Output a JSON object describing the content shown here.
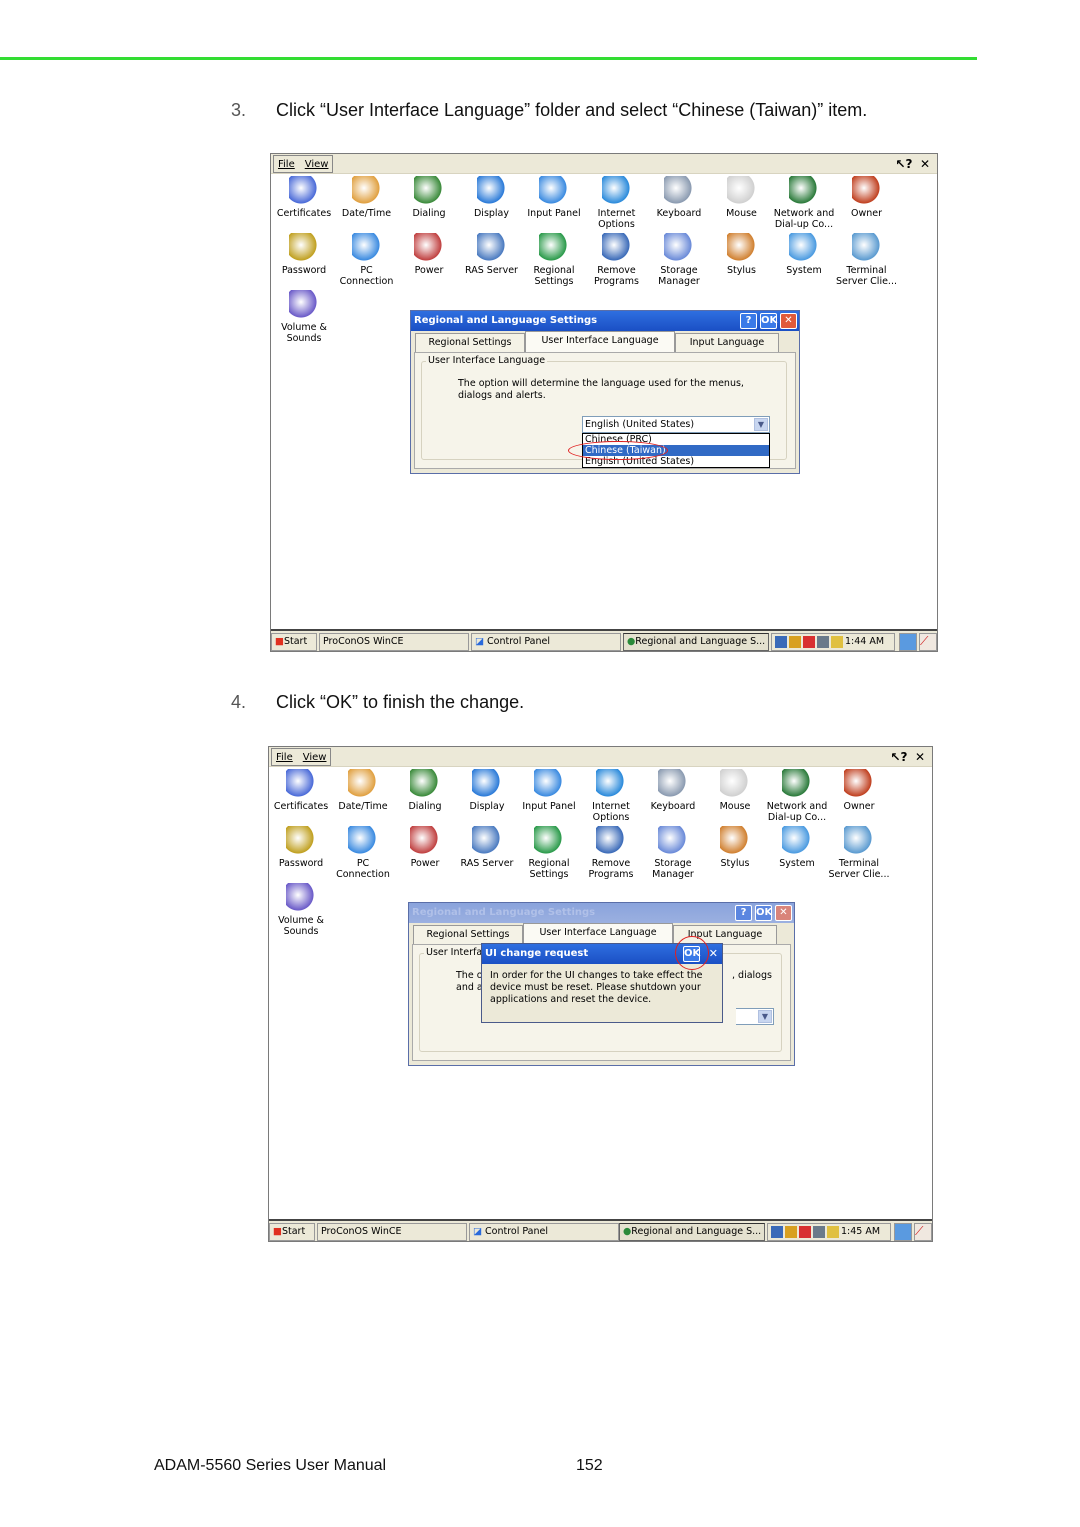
{
  "steps": [
    {
      "number": "3.",
      "text": "Click “User Interface Language” folder and select “Chinese (Taiwan)” item."
    },
    {
      "number": "4.",
      "text": "Click “OK” to finish the change."
    }
  ],
  "footer": {
    "manual": "ADAM-5560 Series User Manual",
    "page": "152"
  },
  "colors": {
    "rule": "#33dd33",
    "title_bar": "#1a4fc4",
    "selection": "#316ac5",
    "highlight_circle": "#e02020"
  },
  "screens": [
    {
      "menu": {
        "file": "File",
        "view": "View",
        "help_icon": "help-question-icon",
        "close_icon": "close-icon"
      },
      "control_panel_items": [
        {
          "label": "Certificates",
          "icon": "certificates-gear-icon"
        },
        {
          "label": "Date/Time",
          "icon": "date-time-clock-icon"
        },
        {
          "label": "Dialing",
          "icon": "dialing-phone-icon"
        },
        {
          "label": "Display",
          "icon": "display-monitor-icon"
        },
        {
          "label": "Input Panel",
          "icon": "input-panel-icon"
        },
        {
          "label": "Internet\nOptions",
          "icon": "internet-options-globe-icon"
        },
        {
          "label": "Keyboard",
          "icon": "keyboard-icon"
        },
        {
          "label": "Mouse",
          "icon": "mouse-icon"
        },
        {
          "label": "Network and\nDial-up Co...",
          "icon": "network-globe-icon"
        },
        {
          "label": "Owner",
          "icon": "owner-people-icon"
        },
        {
          "label": "Password",
          "icon": "password-padlock-icon"
        },
        {
          "label": "PC\nConnection",
          "icon": "pc-connection-icon"
        },
        {
          "label": "Power",
          "icon": "power-battery-icon"
        },
        {
          "label": "RAS Server",
          "icon": "ras-server-icon"
        },
        {
          "label": "Regional\nSettings",
          "icon": "regional-settings-globe-icon"
        },
        {
          "label": "Remove\nPrograms",
          "icon": "remove-programs-icon"
        },
        {
          "label": "Storage\nManager",
          "icon": "storage-manager-pie-icon"
        },
        {
          "label": "Stylus",
          "icon": "stylus-pda-icon"
        },
        {
          "label": "System",
          "icon": "system-computer-icon"
        },
        {
          "label": "Terminal\nServer Clie...",
          "icon": "terminal-server-icon"
        },
        {
          "label": "Volume &\nSounds",
          "icon": "volume-sounds-icon"
        }
      ],
      "dialog": {
        "title": "Regional and Language Settings",
        "buttons": {
          "help": "?",
          "ok": "OK",
          "close": "✕"
        },
        "tabs": [
          "Regional Settings",
          "User Interface Language",
          "Input Language"
        ],
        "active_tab": "User Interface Language",
        "group_label": "User Interface Language",
        "description": "The option will determine the language used for the menus, dialogs and alerts.",
        "combo_value": "English (United States)",
        "dropdown_options": [
          "Chinese (PRC)",
          "Chinese (Taiwan)",
          "English (United States)"
        ],
        "selected_option": "Chinese (Taiwan)"
      },
      "taskbar": {
        "start": "Start",
        "items": [
          "ProConOS WinCE",
          "Control Panel",
          "Regional and Language S..."
        ],
        "clock": "1:44 AM"
      }
    },
    {
      "menu": {
        "file": "File",
        "view": "View",
        "help_icon": "help-question-icon",
        "close_icon": "close-icon"
      },
      "dialog": {
        "title": "Regional and Language Settings",
        "buttons": {
          "help": "?",
          "ok": "OK",
          "close": "✕"
        },
        "tabs": [
          "Regional Settings",
          "User Interface Language",
          "Input Language"
        ],
        "group_label_partial": "User Interface",
        "description_partial_1": "The o",
        "description_partial_2": "and al",
        "description_partial_right": ", dialogs"
      },
      "message_box": {
        "title": "UI change request",
        "ok": "OK",
        "close": "✕",
        "text": "In order for the UI changes to take effect the device must be reset. Please shutdown your applications and reset the device."
      },
      "taskbar": {
        "start": "Start",
        "items": [
          "ProConOS WinCE",
          "Control Panel",
          "Regional and Language S..."
        ],
        "clock": "1:45 AM"
      }
    }
  ]
}
